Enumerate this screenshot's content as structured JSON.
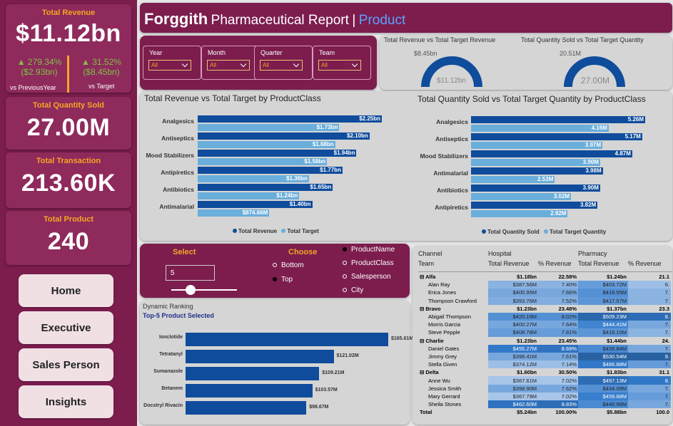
{
  "kpis": {
    "revenue": {
      "label": "Total Revenue",
      "value": "$11.12bn",
      "prev_pct": "▲ 279.34%",
      "prev_amt": "($2.93bn)",
      "prev_label": "vs PreviousYear",
      "tgt_pct": "▲ 31.52%",
      "tgt_amt": "($8.45bn)",
      "tgt_label": "vs Target"
    },
    "quantity": {
      "label": "Total Quantity Sold",
      "value": "27.00M"
    },
    "transaction": {
      "label": "Total Transaction",
      "value": "213.60K"
    },
    "product": {
      "label": "Total Product",
      "value": "240"
    }
  },
  "nav": [
    "Home",
    "Executive",
    "Sales Person",
    "Insights"
  ],
  "header": {
    "brand": "Forggith",
    "title": "Pharmaceutical Report",
    "sep": "|",
    "page": "Product"
  },
  "filters": [
    {
      "label": "Year",
      "value": "All"
    },
    {
      "label": "Month",
      "value": "All"
    },
    {
      "label": "Quarter",
      "value": "All"
    },
    {
      "label": "Team",
      "value": "All"
    }
  ],
  "gauges": [
    {
      "title": "Total Revenue vs Total Target Revenue",
      "target": "$8.45bn",
      "value": "$11.12bn",
      "fill": 1.0
    },
    {
      "title": "Total Quantity Sold vs Total Target Quantity",
      "target": "20.51M",
      "value": "27.00M",
      "fill": 1.0
    }
  ],
  "colors": {
    "primary": "#0f4c9c",
    "secondary": "#6aaedb",
    "brand": "#7c1d4e",
    "accent": "#f5a623",
    "up": "#7ec242"
  },
  "chart_data": [
    {
      "type": "bar",
      "title": "Total Revenue vs Total Target by ProductClass",
      "categories": [
        "Analgesics",
        "Antiseptics",
        "Mood Stabilizers",
        "Antipiretics",
        "Antibiotics",
        "Antimalarial"
      ],
      "series": [
        {
          "name": "Total Revenue",
          "values": [
            2.25,
            2.1,
            1.94,
            1.77,
            1.65,
            1.4
          ],
          "labels": [
            "$2.25bn",
            "$2.10bn",
            "$1.94bn",
            "$1.77bn",
            "$1.65bn",
            "$1.40bn"
          ]
        },
        {
          "name": "Total Target",
          "values": [
            1.73,
            1.68,
            1.58,
            1.36,
            1.24,
            0.87466
          ],
          "labels": [
            "$1.73bn",
            "$1.68bn",
            "$1.58bn",
            "$1.36bn",
            "$1.24bn",
            "$874.66M"
          ]
        }
      ]
    },
    {
      "type": "bar",
      "title": "Total Quantity Sold vs Total Target Quantity by ProductClass",
      "categories": [
        "Analgesics",
        "Antiseptics",
        "Mood Stabilizers",
        "Antimalarial",
        "Antibiotics",
        "Antipiretics"
      ],
      "series": [
        {
          "name": "Total Quantity Sold",
          "values": [
            5.26,
            5.17,
            4.87,
            3.98,
            3.9,
            3.82
          ],
          "labels": [
            "5.26M",
            "5.17M",
            "4.87M",
            "3.98M",
            "3.90M",
            "3.82M"
          ]
        },
        {
          "name": "Total Target Quantity",
          "values": [
            4.16,
            3.97,
            3.9,
            2.53,
            3.02,
            2.92
          ],
          "labels": [
            "4.16M",
            "3.97M",
            "3.90M",
            "2.53M",
            "3.02M",
            "2.92M"
          ]
        }
      ]
    },
    {
      "type": "bar",
      "title": "Dynamic Ranking",
      "subtitle": "Top-5 Product Selected",
      "categories": [
        "Ionclotide",
        "Tetratanyl",
        "Sumanazole",
        "Betanem",
        "Docstryl Rivacin"
      ],
      "series": [
        {
          "values": [
            165.61,
            121.02,
            109.21,
            103.57,
            98.67
          ],
          "labels": [
            "$165.61M",
            "$121.02M",
            "$109.21M",
            "$103.57M",
            "$98.67M"
          ]
        }
      ]
    }
  ],
  "ranking": {
    "select_label": "Select",
    "select_value": "5",
    "choose_label": "Choose",
    "choose_options": [
      "Bottom",
      "Top"
    ],
    "choose_selected": "Top",
    "dims": [
      "ProductName",
      "ProductClass",
      "Salesperson",
      "City"
    ],
    "dim_selected": "ProductName"
  },
  "matrix": {
    "h1": [
      "Channel",
      "Hospital",
      "",
      "Pharmacy",
      ""
    ],
    "h2": [
      "Team",
      "Total Revenue",
      "% Revenue",
      "Total Revenue",
      "% Revenue"
    ],
    "rows": [
      {
        "g": true,
        "c": [
          "Alfa",
          "$1.18bn",
          "22.58%",
          "$1.24bn",
          "21.1"
        ]
      },
      {
        "c": [
          "Alan Ray",
          "$387.56M",
          "7.40%",
          "$403.72M",
          "6."
        ],
        "s": [
          0.3,
          0.3,
          0.5,
          0.2
        ]
      },
      {
        "c": [
          "Erica Jones",
          "$400.95M",
          "7.66%",
          "$419.55M",
          "7."
        ],
        "s": [
          0.4,
          0.4,
          0.6,
          0.3
        ]
      },
      {
        "c": [
          "Thompson Crawford",
          "$393.76M",
          "7.52%",
          "$417.57M",
          "7."
        ],
        "s": [
          0.35,
          0.35,
          0.55,
          0.3
        ]
      },
      {
        "g": true,
        "c": [
          "Bravo",
          "$1.23bn",
          "23.48%",
          "$1.37bn",
          "23.3"
        ]
      },
      {
        "c": [
          "Abigail Thompson",
          "$420.19M",
          "8.02%",
          "$509.23M",
          "8."
        ],
        "s": [
          0.6,
          0.6,
          0.95,
          0.9
        ]
      },
      {
        "c": [
          "Morris Garcia",
          "$400.27M",
          "7.64%",
          "$444.41M",
          "7."
        ],
        "s": [
          0.4,
          0.4,
          0.7,
          0.4
        ]
      },
      {
        "c": [
          "Steve Pepple",
          "$408.78M",
          "7.81%",
          "$418.10M",
          "7."
        ],
        "s": [
          0.5,
          0.5,
          0.55,
          0.3
        ]
      },
      {
        "g": true,
        "c": [
          "Charlie",
          "$1.23bn",
          "23.45%",
          "$1.44bn",
          "24."
        ]
      },
      {
        "c": [
          "Daniel Gates",
          "$455.27M",
          "8.69%",
          "$439.84M",
          "7."
        ],
        "s": [
          0.8,
          0.85,
          0.65,
          0.4
        ]
      },
      {
        "c": [
          "Jimmy Grey",
          "$398.41M",
          "7.61%",
          "$530.54M",
          "9."
        ],
        "s": [
          0.4,
          0.4,
          1.0,
          1.0
        ]
      },
      {
        "c": [
          "Stella Given",
          "$374.12M",
          "7.14%",
          "$466.88M",
          "7."
        ],
        "s": [
          0.2,
          0.2,
          0.8,
          0.5
        ]
      },
      {
        "g": true,
        "c": [
          "Delta",
          "$1.60bn",
          "30.50%",
          "$1.83bn",
          "31.1"
        ]
      },
      {
        "c": [
          "Anne Wu",
          "$367.61M",
          "7.02%",
          "$497.13M",
          "8."
        ],
        "s": [
          0.15,
          0.15,
          0.9,
          0.8
        ]
      },
      {
        "c": [
          "Jessica Smith",
          "$398.90M",
          "7.62%",
          "$434.09M",
          "7."
        ],
        "s": [
          0.4,
          0.4,
          0.6,
          0.4
        ]
      },
      {
        "c": [
          "Mary Gerrard",
          "$367.79M",
          "7.02%",
          "$459.88M",
          "7."
        ],
        "s": [
          0.15,
          0.15,
          0.75,
          0.5
        ]
      },
      {
        "c": [
          "Sheila Stones",
          "$462.60M",
          "8.83%",
          "$440.96M",
          "7."
        ],
        "s": [
          0.85,
          0.9,
          0.65,
          0.4
        ]
      },
      {
        "g": true,
        "t": true,
        "c": [
          "Total",
          "$5.24bn",
          "100.00%",
          "$5.88bn",
          "100.0"
        ]
      }
    ]
  }
}
